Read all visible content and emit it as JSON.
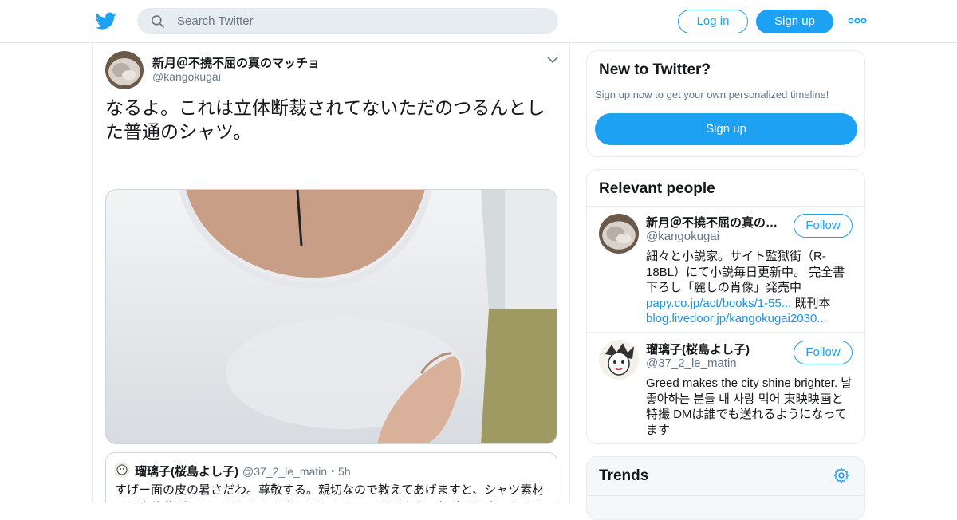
{
  "header": {
    "logo_icon": "twitter-bird-icon",
    "search_placeholder": "Search Twitter",
    "login_label": "Log in",
    "signup_label": "Sign up",
    "more_icon": "more-dots-icon",
    "accent_color": "#1da1f2"
  },
  "tweet": {
    "author_name": "新月＠不撓不屈の真のマッチョ",
    "author_handle": "@kangokugai",
    "text": "なるよ。これは立体断裁されてないただのつるんとした普通のシャツ。",
    "quoted": {
      "author_name": "瑠璃子(桜島よし子)",
      "author_handle": "@37_2_le_matin",
      "time": "・5h",
      "text": "すげー面の皮の暑さだわ。尊敬する。親切なので教えてあげますと、シャツ素材では立体裁断しない限りあんな胸にはならない。私は自分の経験から言いました"
    }
  },
  "sidebar": {
    "new_to_twitter": {
      "title": "New to Twitter?",
      "subtitle": "Sign up now to get your own personalized timeline!",
      "button_label": "Sign up"
    },
    "relevant_people": {
      "title": "Relevant people",
      "people": [
        {
          "name": "新月＠不撓不屈の真の…",
          "handle": "@kangokugai",
          "follow_label": "Follow",
          "bio_text": "細々と小説家。サイト監獄街（R-18BL）にて小説毎日更新中。 完全書下ろし「麗しの肖像」発売中",
          "bio_link1": "papy.co.jp/act/books/1-55...",
          "bio_mid": " 既刊本",
          "bio_link2": "blog.livedoor.jp/kangokugai2030..."
        },
        {
          "name": "瑠璃子(桜島よし子)",
          "handle": "@37_2_le_matin",
          "follow_label": "Follow",
          "bio_text": "Greed makes the city shine brighter. 날 좋아하는 분들 내 사랑 먹어 東映映画と特撮 DMは誰でも送れるようになってます"
        }
      ]
    },
    "trends": {
      "title": "Trends",
      "settings_icon": "gear-icon"
    }
  }
}
